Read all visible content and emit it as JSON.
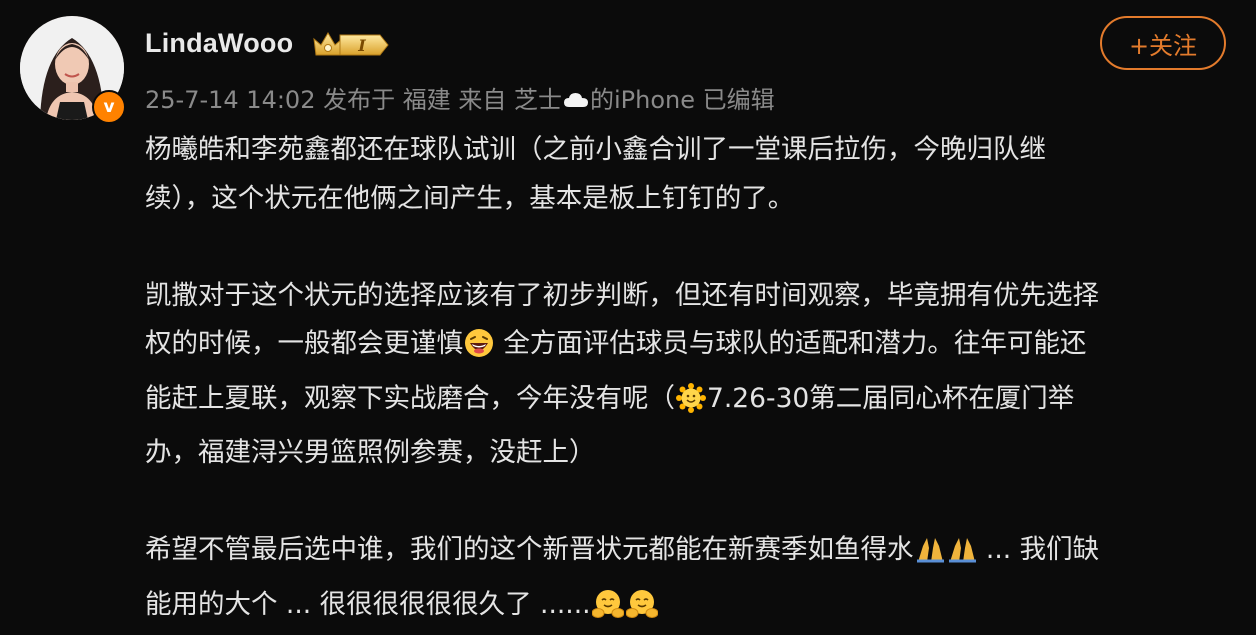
{
  "header": {
    "username": "LindaWooo",
    "badge_text": "I",
    "meta_prefix": "25-7-14 14:02 发布于 福建 来自 芝士",
    "meta_suffix": "的iPhone 已编辑",
    "follow_label": "+关注",
    "verified_mark": "v"
  },
  "post": {
    "p1_line1": "杨曦皓和李苑鑫都还在球队试训（之前小鑫合训了一堂课后拉伤，今晚归队继",
    "p1_line2": "续），这个状元在他俩之间产生，基本是板上钉钉的了。",
    "p2_line1": "凯撒对于这个状元的选择应该有了初步判断，但还有时间观察，毕竟拥有优先选择",
    "p2_line2a": "权的时候，一般都会更谨慎",
    "p2_line2b": " 全方面评估球员与球队的适配和潜力。往年可能还",
    "p2_line3a": "能赶上夏联，观察下实战磨合，今年没有呢（",
    "p2_line3b": "7.26-30第二届同心杯在厦门举",
    "p2_line4": "办，福建浔兴男篮照例参赛，没赶上）",
    "p3_line1a": "希望不管最后选中谁，我们的这个新晋状元都能在新赛季如鱼得水",
    "p3_line1b": " ... 我们缺",
    "p3_line2a": "能用的大个 ... 很很很很很很久了 ......"
  },
  "colors": {
    "background": "#0b0b0b",
    "accent_orange": "#e37b2c",
    "verified_orange": "#ff8200",
    "meta_gray": "#8a8a8a"
  },
  "icons": [
    "crown-level-badge-icon",
    "cloud-icon",
    "grinning-squint-emoji-icon",
    "sun-face-emoji-icon",
    "folded-hands-emoji-icon",
    "hugging-face-emoji-icon"
  ]
}
